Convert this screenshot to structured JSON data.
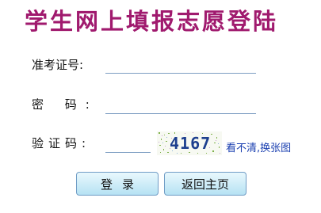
{
  "title": "学生网上填报志愿登陆",
  "form": {
    "exam_id_label": "准考证号:",
    "password_label": "密 码:",
    "captcha_label": "验证码:",
    "exam_id_value": "",
    "password_value": "",
    "captcha_value": "",
    "captcha_image_text": "4167",
    "refresh_link": "看不清,换张图"
  },
  "buttons": {
    "login": "登录",
    "home": "返回主页"
  },
  "colors": {
    "title": "#a01a6e",
    "link": "#1a3fb0",
    "button_top": "#e9f8fd",
    "button_bottom": "#b6e2f3"
  }
}
